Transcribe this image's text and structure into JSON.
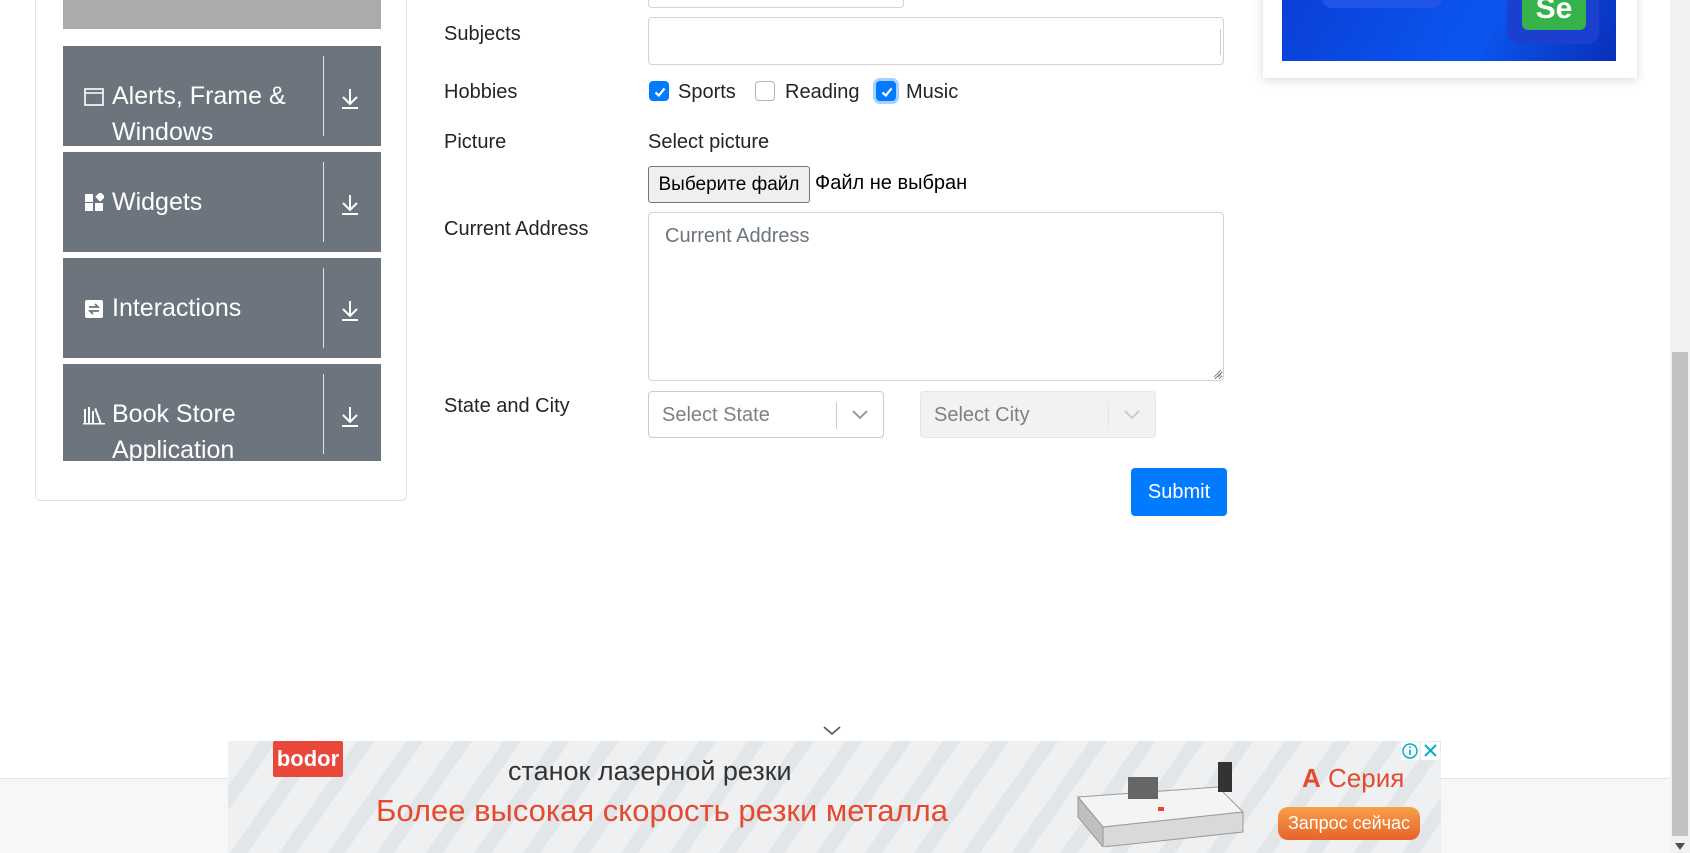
{
  "sidebar": {
    "groups": [
      {
        "title": "Alerts, Frame & Windows",
        "icon": "window-icon"
      },
      {
        "title": "Widgets",
        "icon": "widgets-icon"
      },
      {
        "title": "Interactions",
        "icon": "interactions-icon"
      },
      {
        "title": "Book Store Application",
        "icon": "books-icon"
      }
    ]
  },
  "form": {
    "subjects_label": "Subjects",
    "hobbies_label": "Hobbies",
    "hobbies": [
      {
        "label": "Sports",
        "checked": true
      },
      {
        "label": "Reading",
        "checked": false
      },
      {
        "label": "Music",
        "checked": true
      }
    ],
    "picture_label": "Picture",
    "select_picture": "Select picture",
    "file_button": "Выберите файл",
    "file_status": "Файл не выбран",
    "address_label": "Current Address",
    "address_placeholder": "Current Address",
    "state_city_label": "State and City",
    "state_placeholder": "Select State",
    "city_placeholder": "Select City",
    "submit_label": "Submit"
  },
  "ad_right": {
    "badge": "Se"
  },
  "banner": {
    "logo": "bodor",
    "line1": "станок лазерной резки",
    "line2": "Более высокая скорость резки металла",
    "series_prefix": "A",
    "series_word": "Серия",
    "cta": "Запрос сейчас"
  },
  "colors": {
    "primary": "#007bff",
    "sidebar_group": "#6c757d",
    "banner_accent": "#e64a2e"
  }
}
